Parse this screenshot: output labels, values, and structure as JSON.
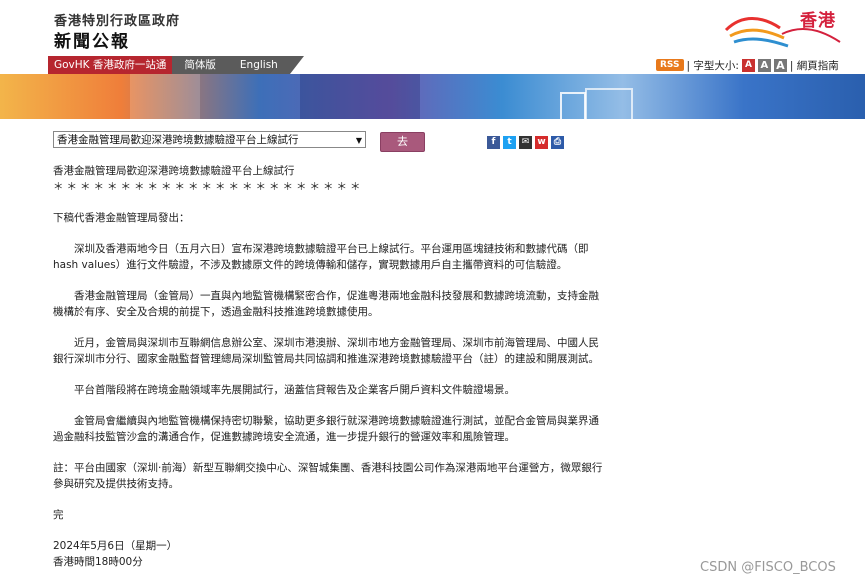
{
  "header": {
    "org": "香港特別行政區政府",
    "title": "新聞公報",
    "logo_text": "香港"
  },
  "nav": {
    "govhk": "GovHK 香港政府一站通",
    "simplified": "简体版",
    "english": "English",
    "rss": "RSS",
    "font_size_label": "| 字型大小:",
    "font_a1": "A",
    "font_a2": "A",
    "font_a3": "A",
    "sitemap": "| 網頁指南"
  },
  "toolbar": {
    "select_value": "香港金融管理局歡迎深港跨境數據驗證平台上線試行",
    "go_label": "去",
    "share_icons": [
      "facebook-icon",
      "twitter-icon",
      "email-icon",
      "weibo-icon",
      "print-icon"
    ]
  },
  "article": {
    "heading": "香港金融管理局歡迎深港跨境數據驗證平台上線試行",
    "stars": "＊＊＊＊＊＊＊＊＊＊＊＊＊＊＊＊＊＊＊＊＊＊＊",
    "intro": "下稿代香港金融管理局發出：",
    "p1": "深圳及香港兩地今日（五月六日）宣布深港跨境數據驗證平台已上線試行。平台運用區塊鏈技術和數據代碼（即hash values）進行文件驗證，不涉及數據原文件的跨境傳輸和儲存，實現數據用戶自主攜帶資料的可信驗證。",
    "p2": "香港金融管理局（金管局）一直與內地監管機構緊密合作，促進粵港兩地金融科技發展和數據跨境流動，支持金融機構於有序、安全及合規的前提下，透過金融科技推進跨境數據使用。",
    "p3": "近月，金管局與深圳市互聯網信息辦公室、深圳市港澳辦、深圳市地方金融管理局、深圳市前海管理局、中國人民銀行深圳市分行、國家金融監督管理總局深圳監管局共同協調和推進深港跨境數據驗證平台（註）的建設和開展測試。",
    "p4": "平台首階段將在跨境金融領域率先展開試行，涵蓋信貸報告及企業客戶開戶資料文件驗證場景。",
    "p5": "金管局會繼續與內地監管機構保持密切聯繫，協助更多銀行就深港跨境數據驗證進行測試，並配合金管局與業界通過金融科技監管沙盒的溝通合作，促進數據跨境安全流通，進一步提升銀行的營運效率和風險管理。",
    "note": "註：平台由國家（深圳·前海）新型互聯網交換中心、深智城集團、香港科技園公司作為深港兩地平台運營方，微眾銀行參與研究及提供技術支持。",
    "end": "完",
    "date": "2024年5月6日（星期一）",
    "time": "香港時間18時00分"
  },
  "watermark": "CSDN @FISCO_BCOS"
}
